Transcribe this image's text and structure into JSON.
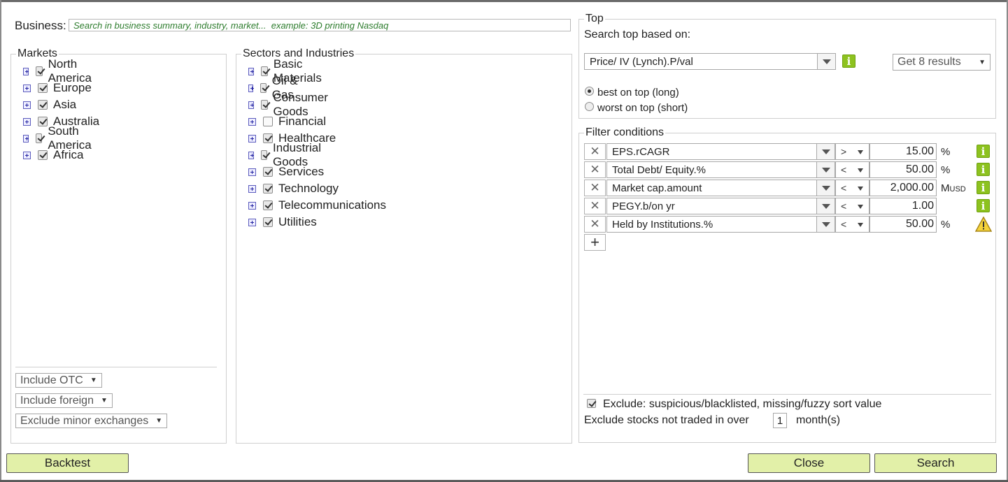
{
  "business": {
    "label": "Business:",
    "placeholder": "Search in business summary, industry, market...  example: 3D printing Nasdaq"
  },
  "markets": {
    "legend": "Markets",
    "items": [
      {
        "label": "North America",
        "checked": true
      },
      {
        "label": "Europe",
        "checked": true
      },
      {
        "label": "Asia",
        "checked": true
      },
      {
        "label": "Australia",
        "checked": true
      },
      {
        "label": "South America",
        "checked": true
      },
      {
        "label": "Africa",
        "checked": true
      }
    ],
    "include_otc": "Include OTC",
    "include_foreign": "Include foreign",
    "exclude_minor": "Exclude minor exchanges"
  },
  "sectors": {
    "legend": "Sectors and Industries",
    "items": [
      {
        "label": "Basic Materials",
        "checked": true
      },
      {
        "label": "Oil & Gas",
        "checked": true
      },
      {
        "label": "Consumer Goods",
        "checked": true
      },
      {
        "label": "Financial",
        "checked": false
      },
      {
        "label": "Healthcare",
        "checked": true
      },
      {
        "label": "Industrial Goods",
        "checked": true
      },
      {
        "label": "Services",
        "checked": true
      },
      {
        "label": "Technology",
        "checked": true
      },
      {
        "label": "Telecommunications",
        "checked": true
      },
      {
        "label": "Utilities",
        "checked": true
      }
    ]
  },
  "top": {
    "legend": "Top",
    "search_label": "Search top based on:",
    "sort_field": "Price/ IV (Lynch).P/val",
    "results": "Get 8 results",
    "best_label": "best on top (long)",
    "worst_label": "worst on top (short)",
    "selected": "best"
  },
  "filters": {
    "legend": "Filter conditions",
    "rows": [
      {
        "field": "EPS.rCAGR",
        "op": ">",
        "value": "15.00",
        "unit": "%",
        "unit_small": "",
        "icon": "info-icon"
      },
      {
        "field": "Total Debt/ Equity.%",
        "op": "<",
        "value": "50.00",
        "unit": "%",
        "unit_small": "",
        "icon": "info-icon"
      },
      {
        "field": "Market cap.amount",
        "op": "<",
        "value": "2,000.00",
        "unit": "M",
        "unit_small": "USD",
        "icon": "info-icon"
      },
      {
        "field": "PEGY.b/on yr",
        "op": "<",
        "value": "1.00",
        "unit": "",
        "unit_small": "",
        "icon": "info-icon"
      },
      {
        "field": "Held by Institutions.%",
        "op": "<",
        "value": "50.00",
        "unit": "%",
        "unit_small": "",
        "icon": "warning-icon"
      }
    ],
    "exclude_label": "Exclude: suspicious/blacklisted, missing/fuzzy sort value",
    "not_traded_label": "Exclude stocks not traded in over",
    "months_value": "1",
    "months_label": "month(s)"
  },
  "buttons": {
    "backtest": "Backtest",
    "close": "Close",
    "search": "Search"
  },
  "colors": {
    "button_bg": "#e2f0a8",
    "info_green": "#8dc21f",
    "placeholder_green": "#2e7d2e"
  }
}
